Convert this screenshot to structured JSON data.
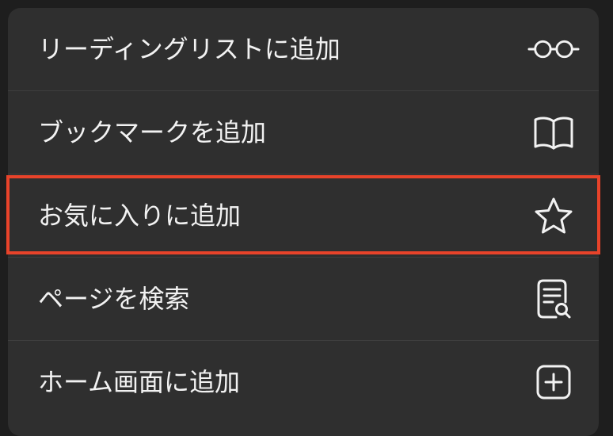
{
  "menu": {
    "items": [
      {
        "label": "リーディングリストに追加",
        "icon": "glasses-icon"
      },
      {
        "label": "ブックマークを追加",
        "icon": "book-icon"
      },
      {
        "label": "お気に入りに追加",
        "icon": "star-icon"
      },
      {
        "label": "ページを検索",
        "icon": "find-in-page-icon"
      },
      {
        "label": "ホーム画面に追加",
        "icon": "add-square-icon"
      }
    ]
  },
  "colors": {
    "background": "#1e1e1e",
    "sheet": "#2f2f2f",
    "text": "#f2f2f2",
    "highlight_border": "#e8432a"
  }
}
